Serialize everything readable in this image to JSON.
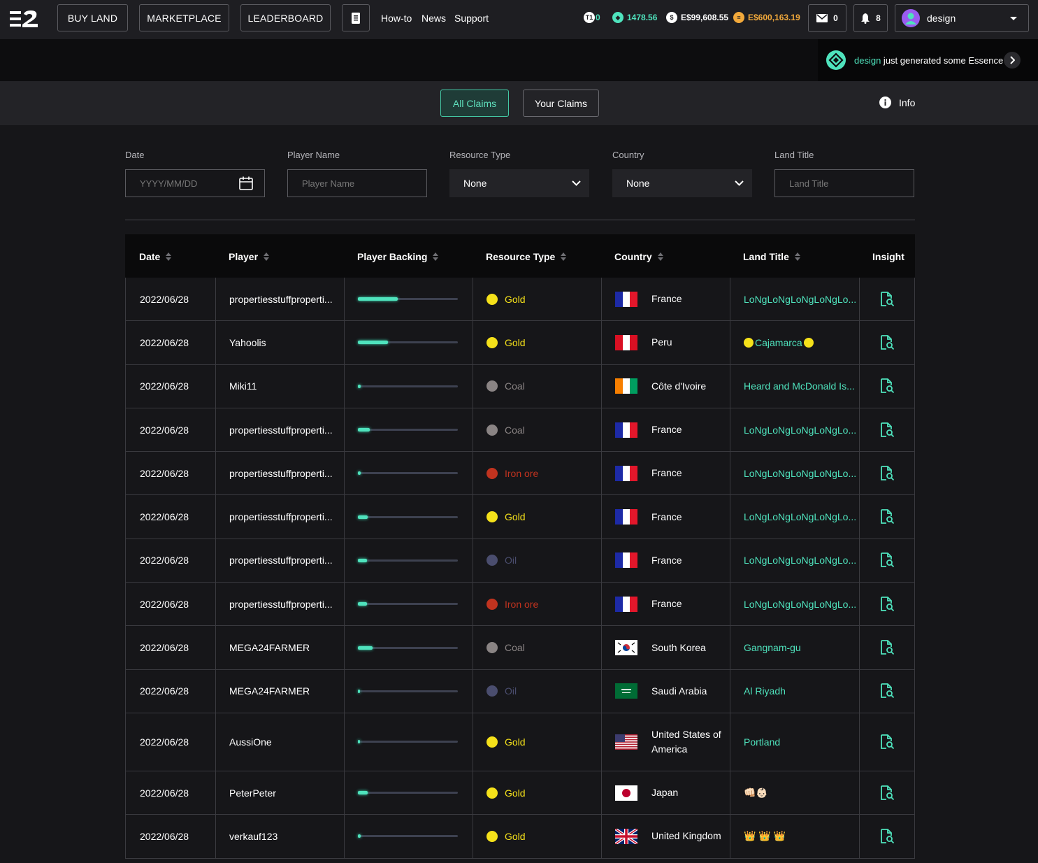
{
  "nav": {
    "buy_land": "BUY LAND",
    "marketplace": "MARKETPLACE",
    "leaderboard": "LEADERBOARD",
    "howto": "How-to",
    "news": "News",
    "support": "Support"
  },
  "stats": {
    "t1_badge": "T1",
    "t1_value": "0",
    "essence": "1478.56",
    "dollars": "E$99,608.55",
    "gold_coins": "E$600,163.19",
    "mail_count": "0",
    "notif_count": "8",
    "username": "design"
  },
  "toast": {
    "user": "design",
    "message": " just generated some Essence"
  },
  "tabs": {
    "all": "All Claims",
    "yours": "Your Claims",
    "info": "Info"
  },
  "filters": {
    "date_label": "Date",
    "date_placeholder": "YYYY/MM/DD",
    "player_label": "Player Name",
    "player_placeholder": "Player Name",
    "resource_label": "Resource Type",
    "resource_value": "None",
    "country_label": "Country",
    "country_value": "None",
    "land_label": "Land Title",
    "land_placeholder": "Land Title"
  },
  "table": {
    "headers": {
      "date": "Date",
      "player": "Player",
      "backing": "Player Backing",
      "resource": "Resource Type",
      "country": "Country",
      "land": "Land Title",
      "insight": "Insight"
    },
    "rows": [
      {
        "date": "2022/06/28",
        "player": "propertiesstuffproperti...",
        "backing": 0.4,
        "resource": "Gold",
        "country": "France",
        "flag": "fr",
        "land": "LoNgLoNgLoNgLoNgLo..."
      },
      {
        "date": "2022/06/28",
        "player": "Yahoolis",
        "backing": 0.3,
        "resource": "Gold",
        "country": "Peru",
        "flag": "pe",
        "land": "Cajamarca",
        "land_dots": true
      },
      {
        "date": "2022/06/28",
        "player": "Miki11",
        "backing": 0.03,
        "resource": "Coal",
        "country": "Côte d'Ivoire",
        "flag": "ci",
        "land": "Heard and McDonald Is..."
      },
      {
        "date": "2022/06/28",
        "player": "propertiesstuffproperti...",
        "backing": 0.12,
        "resource": "Coal",
        "country": "France",
        "flag": "fr",
        "land": "LoNgLoNgLoNgLoNgLo..."
      },
      {
        "date": "2022/06/28",
        "player": "propertiesstuffproperti...",
        "backing": 0.03,
        "resource": "Iron ore",
        "country": "France",
        "flag": "fr",
        "land": "LoNgLoNgLoNgLoNgLo..."
      },
      {
        "date": "2022/06/28",
        "player": "propertiesstuffproperti...",
        "backing": 0.1,
        "resource": "Gold",
        "country": "France",
        "flag": "fr",
        "land": "LoNgLoNgLoNgLoNgLo..."
      },
      {
        "date": "2022/06/28",
        "player": "propertiesstuffproperti...",
        "backing": 0.09,
        "resource": "Oil",
        "country": "France",
        "flag": "fr",
        "land": "LoNgLoNgLoNgLoNgLo..."
      },
      {
        "date": "2022/06/28",
        "player": "propertiesstuffproperti...",
        "backing": 0.09,
        "resource": "Iron ore",
        "country": "France",
        "flag": "fr",
        "land": "LoNgLoNgLoNgLoNgLo..."
      },
      {
        "date": "2022/06/28",
        "player": "MEGA24FARMER",
        "backing": 0.15,
        "resource": "Coal",
        "country": "South Korea",
        "flag": "kr",
        "land": "Gangnam-gu"
      },
      {
        "date": "2022/06/28",
        "player": "MEGA24FARMER",
        "backing": 0.01,
        "resource": "Oil",
        "country": "Saudi Arabia",
        "flag": "sa",
        "land": "Al Riyadh"
      },
      {
        "date": "2022/06/28",
        "player": "AussiOne",
        "backing": 0.01,
        "resource": "Gold",
        "country": "United States of America",
        "flag": "us",
        "land": "Portland",
        "tall": true
      },
      {
        "date": "2022/06/28",
        "player": "PeterPeter",
        "backing": 0.1,
        "resource": "Gold",
        "country": "Japan",
        "flag": "jp",
        "land": "👊🏻👶🏻"
      },
      {
        "date": "2022/06/28",
        "player": "verkauf123",
        "backing": 0.03,
        "resource": "Gold",
        "country": "United Kingdom",
        "flag": "gb",
        "land": "👑 👑 👑"
      }
    ]
  },
  "colors": {
    "accent": "#4fe3bd",
    "gold": "#f5e11a",
    "coal": "#8a8484",
    "iron": "#c0331f",
    "oil": "#4a4d6e"
  }
}
